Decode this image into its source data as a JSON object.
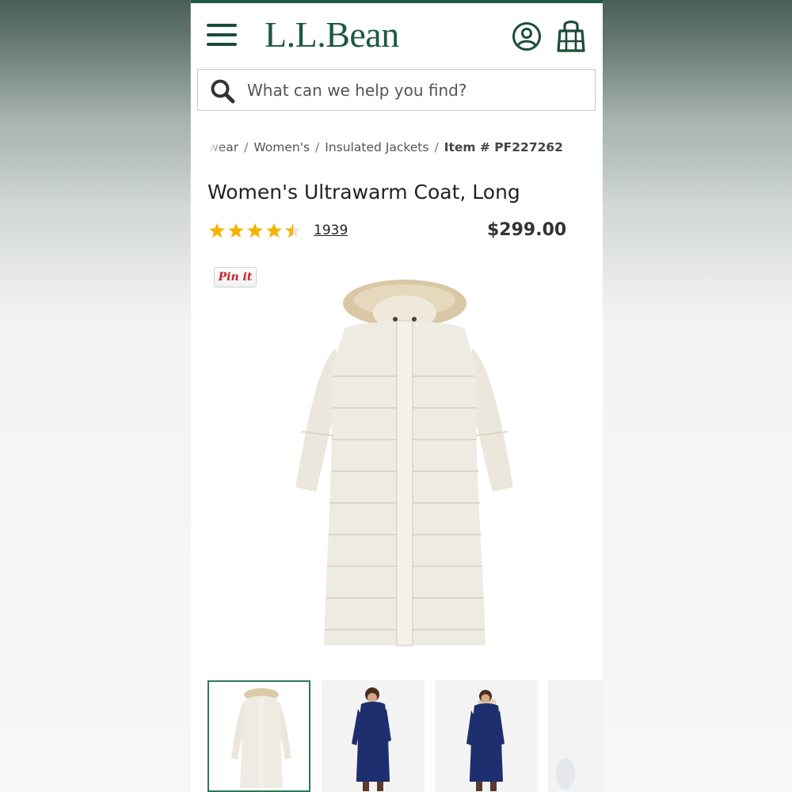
{
  "header": {
    "brand": "L.L.Bean"
  },
  "search": {
    "placeholder": "What can we help you find?"
  },
  "breadcrumb": {
    "items": [
      "wear",
      "Women's",
      "Insulated Jackets"
    ],
    "item_number": "Item # PF227262"
  },
  "product": {
    "title": "Women's Ultrawarm Coat, Long",
    "rating": 4.5,
    "review_count": "1939",
    "price": "$299.00",
    "pin_label": "Pin it"
  },
  "colors": {
    "brand_green": "#1b5a3e",
    "star_gold": "#f5b301",
    "active_thumb_border": "#2c7a55"
  },
  "thumbnails": [
    {
      "color": "cream",
      "selected": true
    },
    {
      "color": "navy",
      "selected": false
    },
    {
      "color": "navy",
      "selected": false
    }
  ]
}
